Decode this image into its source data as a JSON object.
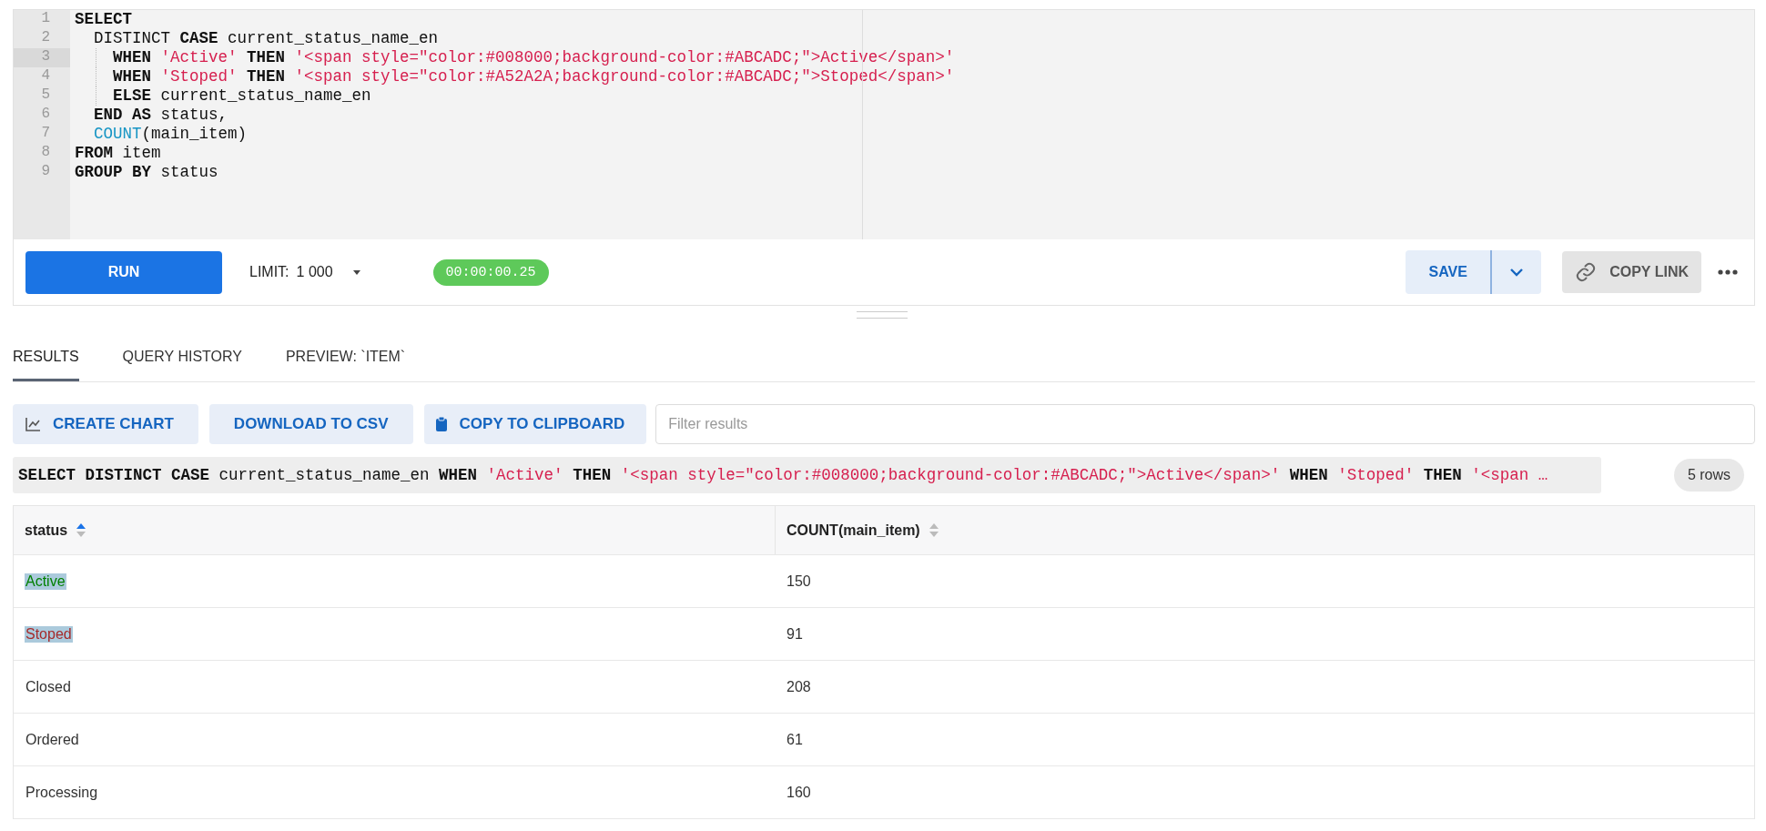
{
  "editor": {
    "lines": [
      {
        "number": "1",
        "active": false,
        "guide": false,
        "tokens": [
          {
            "kind": "keyword",
            "text": "SELECT"
          }
        ]
      },
      {
        "number": "2",
        "active": false,
        "guide": false,
        "tokens": [
          {
            "kind": "plain",
            "text": "  DISTINCT "
          },
          {
            "kind": "keyword",
            "text": "CASE"
          },
          {
            "kind": "plain",
            "text": " current_status_name_en"
          }
        ]
      },
      {
        "number": "3",
        "active": true,
        "guide": true,
        "tokens": [
          {
            "kind": "keyword",
            "text": "WHEN"
          },
          {
            "kind": "string",
            "text": " 'Active'"
          },
          {
            "kind": "keyword",
            "text": " THEN"
          },
          {
            "kind": "string",
            "text": " '<span style=\"color:#008000;background-color:#ABCADC;\">Active</span>'"
          }
        ]
      },
      {
        "number": "4",
        "active": false,
        "guide": true,
        "tokens": [
          {
            "kind": "keyword",
            "text": "WHEN"
          },
          {
            "kind": "string",
            "text": " 'Stoped'"
          },
          {
            "kind": "keyword",
            "text": " THEN"
          },
          {
            "kind": "string",
            "text": " '<span style=\"color:#A52A2A;background-color:#ABCADC;\">Stoped</span>'"
          }
        ]
      },
      {
        "number": "5",
        "active": false,
        "guide": true,
        "tokens": [
          {
            "kind": "keyword",
            "text": "ELSE"
          },
          {
            "kind": "plain",
            "text": " current_status_name_en"
          }
        ]
      },
      {
        "number": "6",
        "active": false,
        "guide": false,
        "tokens": [
          {
            "kind": "keyword",
            "text": "  END AS"
          },
          {
            "kind": "plain",
            "text": " status,"
          }
        ]
      },
      {
        "number": "7",
        "active": false,
        "guide": false,
        "tokens": [
          {
            "kind": "function",
            "text": "  COUNT"
          },
          {
            "kind": "plain",
            "text": "(main_item)"
          }
        ]
      },
      {
        "number": "8",
        "active": false,
        "guide": false,
        "tokens": [
          {
            "kind": "keyword",
            "text": "FROM"
          },
          {
            "kind": "plain",
            "text": " item"
          }
        ]
      },
      {
        "number": "9",
        "active": false,
        "guide": false,
        "tokens": [
          {
            "kind": "keyword",
            "text": "GROUP BY"
          },
          {
            "kind": "plain",
            "text": " status"
          }
        ]
      }
    ]
  },
  "toolbar": {
    "run": "RUN",
    "limit_label": "LIMIT:",
    "limit_value": "1 000",
    "timer": "00:00:00.25",
    "save": "SAVE",
    "copy_link": "COPY LINK"
  },
  "tabs": [
    {
      "label": "RESULTS",
      "selected": true
    },
    {
      "label": "QUERY HISTORY",
      "selected": false
    },
    {
      "label": "PREVIEW: `ITEM`",
      "selected": false
    }
  ],
  "actions": [
    {
      "kind": "chart",
      "label": "CREATE CHART"
    },
    {
      "kind": "plain",
      "label": "DOWNLOAD TO CSV"
    },
    {
      "kind": "clipboard",
      "label": "COPY TO CLIPBOARD"
    }
  ],
  "filter": {
    "placeholder": "Filter results"
  },
  "query_preview": {
    "tokens": [
      {
        "kind": "keyword",
        "text": "SELECT DISTINCT CASE"
      },
      {
        "kind": "plain",
        "text": " current_status_name_en "
      },
      {
        "kind": "keyword",
        "text": "WHEN"
      },
      {
        "kind": "string",
        "text": " 'Active'"
      },
      {
        "kind": "keyword",
        "text": " THEN"
      },
      {
        "kind": "string",
        "text": " '<span style=\"color:#008000;background-color:#ABCADC;\">Active</span>'"
      },
      {
        "kind": "keyword",
        "text": " WHEN"
      },
      {
        "kind": "string",
        "text": " 'Stoped'"
      },
      {
        "kind": "keyword",
        "text": " THEN"
      },
      {
        "kind": "string",
        "text": " '<span …"
      }
    ],
    "row_count": "5 rows"
  },
  "table": {
    "columns": [
      {
        "label": "status",
        "sorted": true
      },
      {
        "label": "COUNT(main_item)",
        "sorted": false
      }
    ],
    "rows": [
      [
        {
          "text": "Active",
          "color": "#008000",
          "highlighted": true
        },
        {
          "text": "150"
        }
      ],
      [
        {
          "text": "Stoped",
          "color": "#a52a2a",
          "highlighted": true
        },
        {
          "text": "91"
        }
      ],
      [
        {
          "text": "Closed"
        },
        {
          "text": "208"
        }
      ],
      [
        {
          "text": "Ordered"
        },
        {
          "text": "61"
        }
      ],
      [
        {
          "text": "Processing"
        },
        {
          "text": "160"
        }
      ]
    ]
  }
}
